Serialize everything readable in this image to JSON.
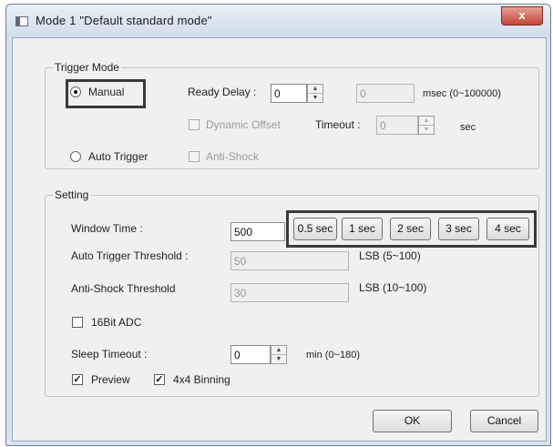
{
  "window": {
    "title": "Mode 1 \"Default standard mode\"",
    "close_label": "x"
  },
  "trigger_mode": {
    "group_label": "Trigger Mode",
    "manual_label": "Manual",
    "auto_trigger_label": "Auto Trigger",
    "ready_delay_label": "Ready Delay :",
    "ready_delay_value": "0",
    "ready_delay_readonly_value": "0",
    "ready_delay_unit": "msec (0~100000)",
    "dynamic_offset_label": "Dynamic Offset",
    "timeout_label": "Timeout :",
    "timeout_value": "0",
    "timeout_unit": "sec",
    "anti_shock_label": "Anti-Shock",
    "selected": "Manual"
  },
  "setting": {
    "group_label": "Setting",
    "window_time_label": "Window Time :",
    "window_time_value": "500",
    "window_time_buttons": [
      "0.5 sec",
      "1 sec",
      "2 sec",
      "3 sec",
      "4 sec"
    ],
    "auto_trigger_threshold_label": "Auto Trigger Threshold :",
    "auto_trigger_threshold_value": "50",
    "auto_trigger_threshold_unit": "LSB (5~100)",
    "anti_shock_threshold_label": "Anti-Shock Threshold",
    "anti_shock_threshold_value": "30",
    "anti_shock_threshold_unit": "LSB (10~100)",
    "adc_16bit_label": "16Bit ADC",
    "adc_16bit_checked": false,
    "sleep_timeout_label": "Sleep Timeout :",
    "sleep_timeout_value": "0",
    "sleep_timeout_unit": "min (0~180)",
    "preview_label": "Preview",
    "preview_checked": true,
    "binning_label": "4x4 Binning",
    "binning_checked": true
  },
  "dialog_buttons": {
    "ok_label": "OK",
    "cancel_label": "Cancel"
  },
  "glyphs": {
    "check": "✓",
    "spin_up": "▲",
    "spin_down": "▼"
  }
}
